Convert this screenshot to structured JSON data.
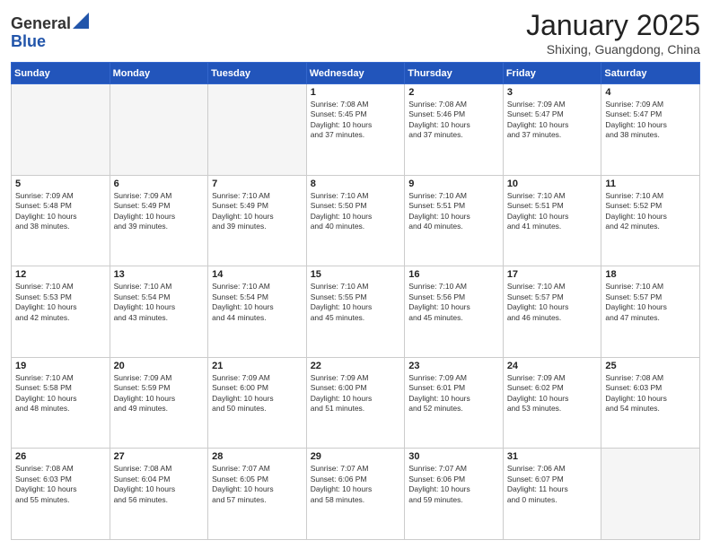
{
  "header": {
    "logo_general": "General",
    "logo_blue": "Blue",
    "month_title": "January 2025",
    "subtitle": "Shixing, Guangdong, China"
  },
  "days_of_week": [
    "Sunday",
    "Monday",
    "Tuesday",
    "Wednesday",
    "Thursday",
    "Friday",
    "Saturday"
  ],
  "weeks": [
    [
      {
        "num": "",
        "info": ""
      },
      {
        "num": "",
        "info": ""
      },
      {
        "num": "",
        "info": ""
      },
      {
        "num": "1",
        "info": "Sunrise: 7:08 AM\nSunset: 5:45 PM\nDaylight: 10 hours\nand 37 minutes."
      },
      {
        "num": "2",
        "info": "Sunrise: 7:08 AM\nSunset: 5:46 PM\nDaylight: 10 hours\nand 37 minutes."
      },
      {
        "num": "3",
        "info": "Sunrise: 7:09 AM\nSunset: 5:47 PM\nDaylight: 10 hours\nand 37 minutes."
      },
      {
        "num": "4",
        "info": "Sunrise: 7:09 AM\nSunset: 5:47 PM\nDaylight: 10 hours\nand 38 minutes."
      }
    ],
    [
      {
        "num": "5",
        "info": "Sunrise: 7:09 AM\nSunset: 5:48 PM\nDaylight: 10 hours\nand 38 minutes."
      },
      {
        "num": "6",
        "info": "Sunrise: 7:09 AM\nSunset: 5:49 PM\nDaylight: 10 hours\nand 39 minutes."
      },
      {
        "num": "7",
        "info": "Sunrise: 7:10 AM\nSunset: 5:49 PM\nDaylight: 10 hours\nand 39 minutes."
      },
      {
        "num": "8",
        "info": "Sunrise: 7:10 AM\nSunset: 5:50 PM\nDaylight: 10 hours\nand 40 minutes."
      },
      {
        "num": "9",
        "info": "Sunrise: 7:10 AM\nSunset: 5:51 PM\nDaylight: 10 hours\nand 40 minutes."
      },
      {
        "num": "10",
        "info": "Sunrise: 7:10 AM\nSunset: 5:51 PM\nDaylight: 10 hours\nand 41 minutes."
      },
      {
        "num": "11",
        "info": "Sunrise: 7:10 AM\nSunset: 5:52 PM\nDaylight: 10 hours\nand 42 minutes."
      }
    ],
    [
      {
        "num": "12",
        "info": "Sunrise: 7:10 AM\nSunset: 5:53 PM\nDaylight: 10 hours\nand 42 minutes."
      },
      {
        "num": "13",
        "info": "Sunrise: 7:10 AM\nSunset: 5:54 PM\nDaylight: 10 hours\nand 43 minutes."
      },
      {
        "num": "14",
        "info": "Sunrise: 7:10 AM\nSunset: 5:54 PM\nDaylight: 10 hours\nand 44 minutes."
      },
      {
        "num": "15",
        "info": "Sunrise: 7:10 AM\nSunset: 5:55 PM\nDaylight: 10 hours\nand 45 minutes."
      },
      {
        "num": "16",
        "info": "Sunrise: 7:10 AM\nSunset: 5:56 PM\nDaylight: 10 hours\nand 45 minutes."
      },
      {
        "num": "17",
        "info": "Sunrise: 7:10 AM\nSunset: 5:57 PM\nDaylight: 10 hours\nand 46 minutes."
      },
      {
        "num": "18",
        "info": "Sunrise: 7:10 AM\nSunset: 5:57 PM\nDaylight: 10 hours\nand 47 minutes."
      }
    ],
    [
      {
        "num": "19",
        "info": "Sunrise: 7:10 AM\nSunset: 5:58 PM\nDaylight: 10 hours\nand 48 minutes."
      },
      {
        "num": "20",
        "info": "Sunrise: 7:09 AM\nSunset: 5:59 PM\nDaylight: 10 hours\nand 49 minutes."
      },
      {
        "num": "21",
        "info": "Sunrise: 7:09 AM\nSunset: 6:00 PM\nDaylight: 10 hours\nand 50 minutes."
      },
      {
        "num": "22",
        "info": "Sunrise: 7:09 AM\nSunset: 6:00 PM\nDaylight: 10 hours\nand 51 minutes."
      },
      {
        "num": "23",
        "info": "Sunrise: 7:09 AM\nSunset: 6:01 PM\nDaylight: 10 hours\nand 52 minutes."
      },
      {
        "num": "24",
        "info": "Sunrise: 7:09 AM\nSunset: 6:02 PM\nDaylight: 10 hours\nand 53 minutes."
      },
      {
        "num": "25",
        "info": "Sunrise: 7:08 AM\nSunset: 6:03 PM\nDaylight: 10 hours\nand 54 minutes."
      }
    ],
    [
      {
        "num": "26",
        "info": "Sunrise: 7:08 AM\nSunset: 6:03 PM\nDaylight: 10 hours\nand 55 minutes."
      },
      {
        "num": "27",
        "info": "Sunrise: 7:08 AM\nSunset: 6:04 PM\nDaylight: 10 hours\nand 56 minutes."
      },
      {
        "num": "28",
        "info": "Sunrise: 7:07 AM\nSunset: 6:05 PM\nDaylight: 10 hours\nand 57 minutes."
      },
      {
        "num": "29",
        "info": "Sunrise: 7:07 AM\nSunset: 6:06 PM\nDaylight: 10 hours\nand 58 minutes."
      },
      {
        "num": "30",
        "info": "Sunrise: 7:07 AM\nSunset: 6:06 PM\nDaylight: 10 hours\nand 59 minutes."
      },
      {
        "num": "31",
        "info": "Sunrise: 7:06 AM\nSunset: 6:07 PM\nDaylight: 11 hours\nand 0 minutes."
      },
      {
        "num": "",
        "info": ""
      }
    ]
  ]
}
